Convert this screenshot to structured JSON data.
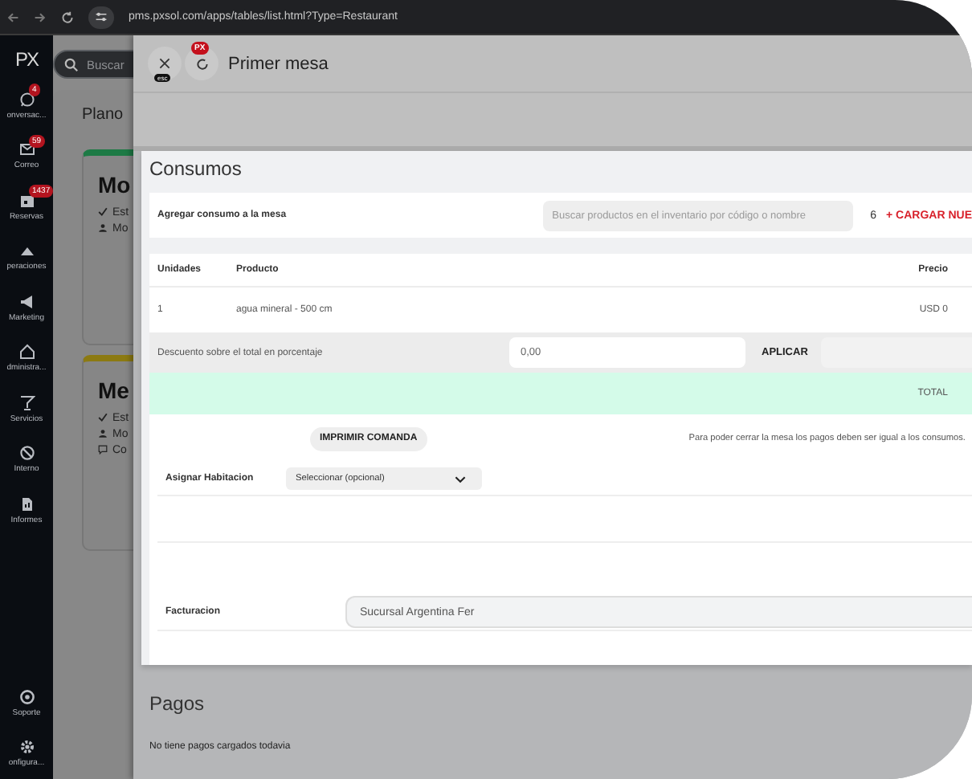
{
  "browser": {
    "url": "pms.pxsol.com/apps/tables/list.html?Type=Restaurant"
  },
  "sidebar": {
    "logo": "PX",
    "items": [
      {
        "label": "onversac...",
        "badge": "4"
      },
      {
        "label": "Correo",
        "badge": "59"
      },
      {
        "label": "Reservas",
        "badge": "1437"
      },
      {
        "label": "peraciones"
      },
      {
        "label": "Marketing"
      },
      {
        "label": "dministra..."
      },
      {
        "label": "Servicios"
      },
      {
        "label": "Interno"
      },
      {
        "label": "Informes"
      }
    ],
    "bottom_items": [
      {
        "label": "Soporte"
      },
      {
        "label": "onfigura..."
      }
    ]
  },
  "background_page": {
    "search_placeholder": "Buscar",
    "heading": "Plano",
    "cards": [
      {
        "title": "Mo",
        "color": "#1d7a45",
        "lines": [
          {
            "kind": "status",
            "text": "Est"
          },
          {
            "kind": "person",
            "text": "Mo"
          }
        ]
      },
      {
        "title": "Me",
        "color": "#8c7a12",
        "lines": [
          {
            "kind": "status",
            "text": "Est"
          },
          {
            "kind": "person",
            "text": "Mo"
          },
          {
            "kind": "comment",
            "text": "Co"
          }
        ]
      }
    ]
  },
  "modal": {
    "title": "Primer mesa",
    "close_hint": "esc",
    "refresh_badge": "PX",
    "consumos": {
      "title": "Consumos",
      "add_label": "Agregar consumo a la mesa",
      "search_placeholder": "Buscar productos en el inventario por código o nombre",
      "count": "6",
      "add_button": "+ CARGAR NUE",
      "columns": [
        "Unidades",
        "Producto",
        "Precio"
      ],
      "rows": [
        [
          "1",
          "agua mineral - 500 cm",
          "USD 0"
        ]
      ],
      "discount_label": "Descuento sobre el total en porcentaje",
      "discount_value": "0,00",
      "apply_button": "APLICAR",
      "total_label": "TOTAL",
      "print_button": "IMPRIMIR COMANDA",
      "note": "Para poder cerrar la mesa los pagos deben ser igual a los consumos.",
      "room_label": "Asignar Habitacion",
      "room_placeholder": "Seleccionar (opcional)",
      "billing_label": "Facturacion",
      "billing_value": "Sucursal Argentina Fer"
    },
    "pagos": {
      "title": "Pagos",
      "empty_text": "No tiene pagos cargados todavia"
    }
  }
}
